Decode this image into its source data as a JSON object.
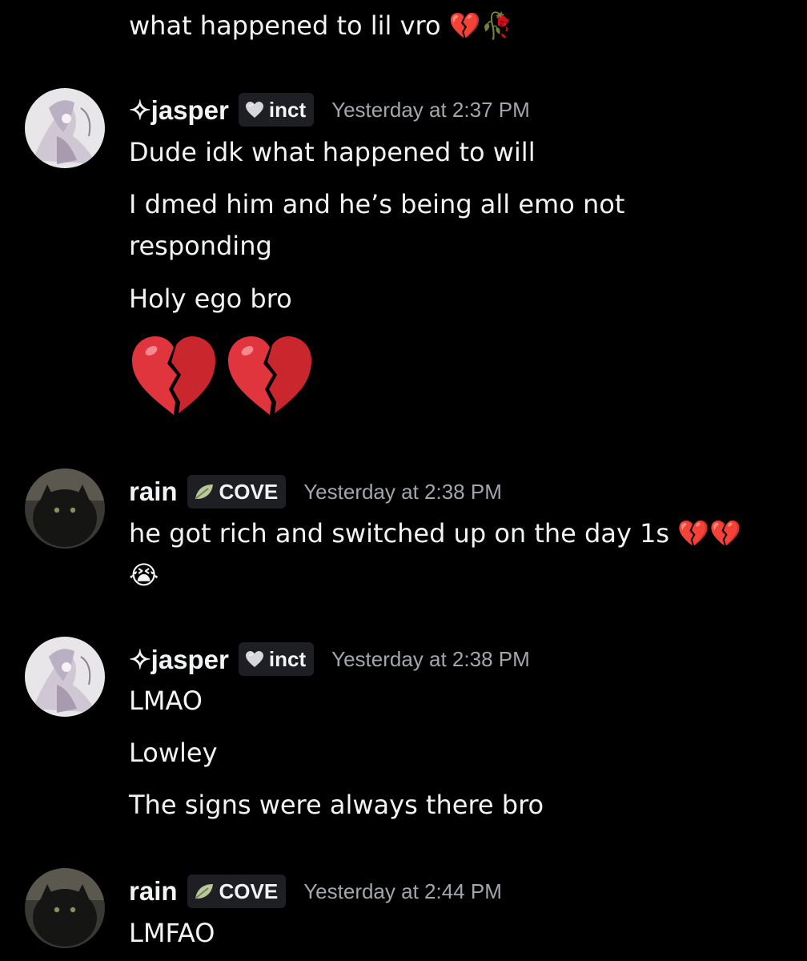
{
  "messages": {
    "top": {
      "text": "what happened to lil vro",
      "emojis": [
        "💔",
        "🥀"
      ]
    },
    "group1": {
      "username": "✧jasper",
      "tag": "inct",
      "tag_icon": "heart-icon",
      "timestamp": "Yesterday at 2:37 PM",
      "lines": [
        "Dude idk what happened to will",
        "I dmed him and he’s being all emo not responding",
        "Holy ego bro"
      ],
      "big_emojis": [
        "💔",
        "💔"
      ]
    },
    "group2": {
      "username": "rain",
      "tag": "COVE",
      "tag_icon": "leaf-icon",
      "timestamp": "Yesterday at 2:38 PM",
      "text": "he got rich and switched up on the day 1s",
      "emojis": [
        "💔",
        "💔",
        "😭"
      ]
    },
    "group3": {
      "username": "✧jasper",
      "tag": "inct",
      "tag_icon": "heart-icon",
      "timestamp": "Yesterday at 2:38 PM",
      "lines": [
        "LMAO",
        "Lowley",
        "The signs were always there bro"
      ]
    },
    "group4": {
      "username": "rain",
      "tag": "COVE",
      "tag_icon": "leaf-icon",
      "timestamp": "Yesterday at 2:44 PM",
      "lines": [
        "LMFAO"
      ]
    }
  },
  "colors": {
    "background": "#000000",
    "text": "#f2f3f5",
    "timestamp": "#a3a6ad",
    "tag_bg": "#1e1f22",
    "heart_emoji": "#e0353c",
    "rose": "#c0333a"
  }
}
